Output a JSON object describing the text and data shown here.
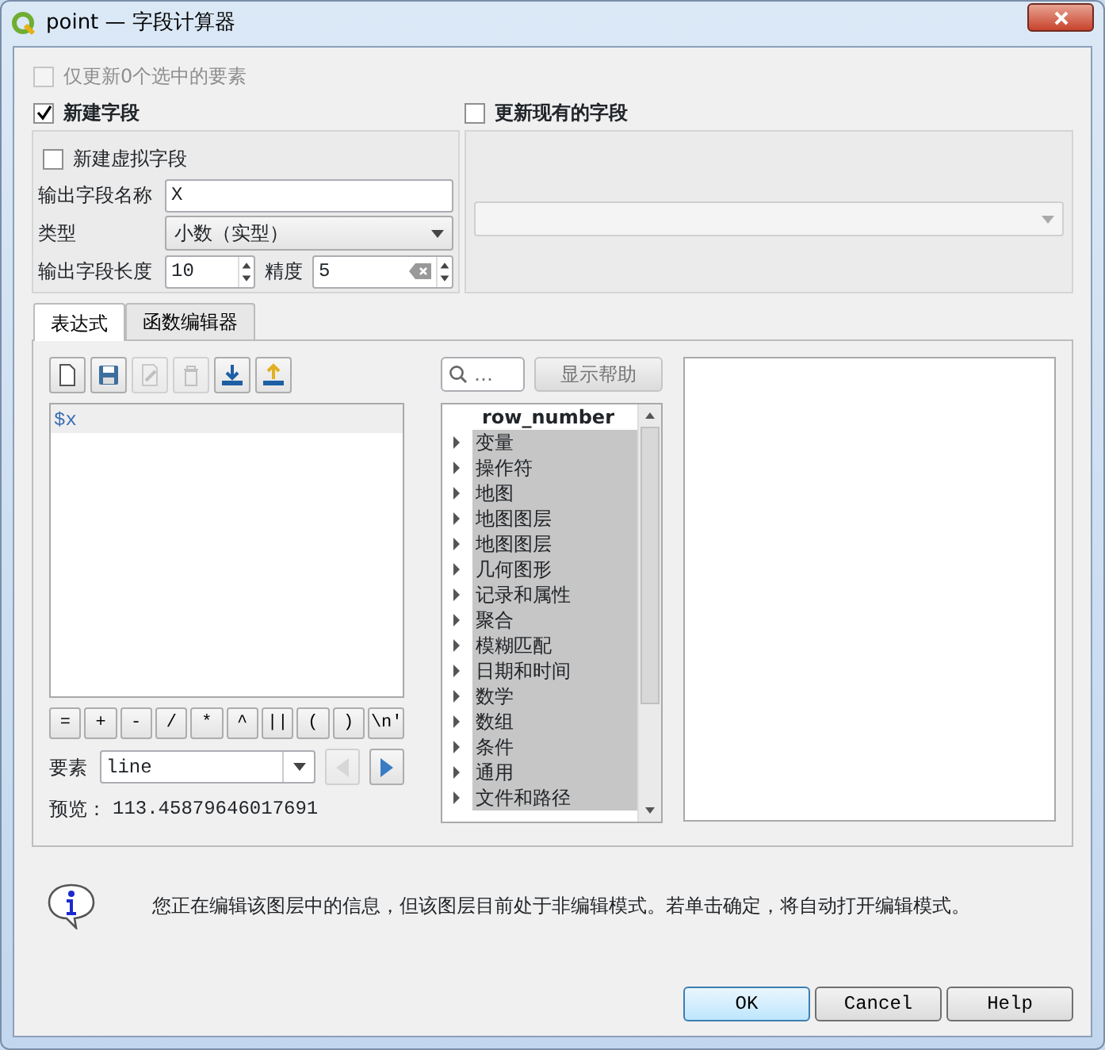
{
  "window": {
    "title": "point — 字段计算器"
  },
  "only_selected": {
    "label": "仅更新0个选中的要素",
    "checked": false,
    "disabled": true
  },
  "new_field": {
    "label": "新建字段",
    "checked": true,
    "virtual": {
      "label": "新建虚拟字段",
      "checked": false
    },
    "name": {
      "label": "输出字段名称",
      "value": "X"
    },
    "type": {
      "label": "类型",
      "value": "小数（实型）"
    },
    "length": {
      "label": "输出字段长度",
      "value": "10"
    },
    "precision": {
      "label": "精度",
      "value": "5"
    }
  },
  "update_existing": {
    "label": "更新现有的字段",
    "checked": false
  },
  "tabs": [
    {
      "label": "表达式",
      "selected": true
    },
    {
      "label": "函数编辑器",
      "selected": false
    }
  ],
  "toolbar": [
    {
      "kind": "new",
      "disabled": false
    },
    {
      "kind": "save",
      "disabled": false
    },
    {
      "kind": "edit",
      "disabled": true
    },
    {
      "kind": "delete",
      "disabled": true
    },
    {
      "kind": "import",
      "disabled": false
    },
    {
      "kind": "export",
      "disabled": false
    }
  ],
  "expression": "$x",
  "operators": [
    "=",
    "+",
    "-",
    "/",
    "*",
    "^",
    "||",
    "(",
    ")",
    "\\n'"
  ],
  "feature": {
    "label": "要素",
    "value": "line",
    "prev_disabled": true,
    "next_disabled": false
  },
  "preview": {
    "label": "预览：",
    "value": "113.45879646017691"
  },
  "search": {
    "placeholder": "…"
  },
  "show_help": "显示帮助",
  "functions": [
    {
      "label": "row_number",
      "expandable": false
    },
    {
      "label": "变量",
      "expandable": true
    },
    {
      "label": "操作符",
      "expandable": true
    },
    {
      "label": "地图",
      "expandable": true
    },
    {
      "label": "地图图层",
      "expandable": true
    },
    {
      "label": "地图图层",
      "expandable": true
    },
    {
      "label": "几何图形",
      "expandable": true
    },
    {
      "label": "记录和属性",
      "expandable": true
    },
    {
      "label": "聚合",
      "expandable": true
    },
    {
      "label": "模糊匹配",
      "expandable": true
    },
    {
      "label": "日期和时间",
      "expandable": true
    },
    {
      "label": "数学",
      "expandable": true
    },
    {
      "label": "数组",
      "expandable": true
    },
    {
      "label": "条件",
      "expandable": true
    },
    {
      "label": "通用",
      "expandable": true
    },
    {
      "label": "文件和路径",
      "expandable": true
    }
  ],
  "message": "您正在编辑该图层中的信息，但该图层目前处于非编辑模式。若单击确定，将自动打开编辑模式。",
  "buttons": [
    "OK",
    "Cancel",
    "Help"
  ]
}
